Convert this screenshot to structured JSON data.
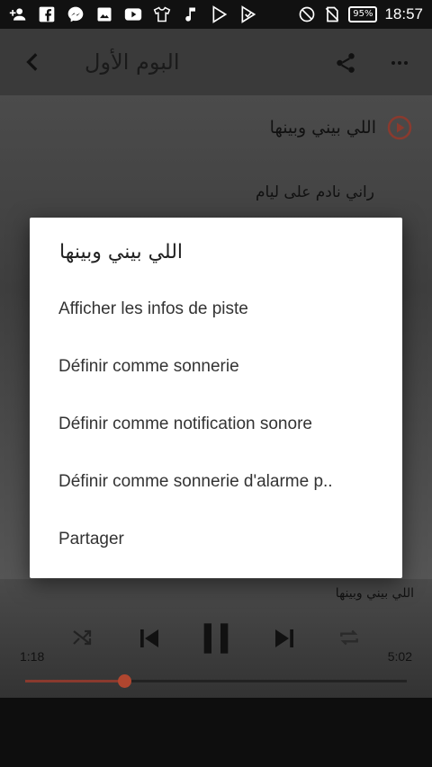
{
  "status_bar": {
    "icons": [
      "add-person-icon",
      "facebook-icon",
      "messenger-icon",
      "image-icon",
      "youtube-icon",
      "shirt-icon",
      "music-note-icon",
      "play-store-icon",
      "play-store-icon",
      "no-disturb-icon",
      "no-sim-icon"
    ],
    "battery": "95%",
    "time": "18:57"
  },
  "appbar": {
    "title": "البوم الأول",
    "back_icon": "back-arrow-icon",
    "share_icon": "share-icon",
    "more_icon": "more-vert-icon"
  },
  "content": {
    "now_playing_title": "اللي بيني وبينها",
    "track_item": "راني نادم على ليام"
  },
  "player": {
    "title": "اللي بيني وبينها",
    "elapsed": "1:18",
    "duration": "5:02",
    "progress": 0.26
  },
  "dialog": {
    "title": "اللي بيني وبينها",
    "items": [
      "Afficher les infos de piste",
      "Définir comme sonnerie",
      "Définir comme notification sonore",
      "Définir comme sonnerie d'alarme p..",
      "Partager"
    ]
  },
  "colors": {
    "accent": "#b0462f",
    "dialog_bg": "#ffffff",
    "appbar_bg": "#3a3a3a"
  }
}
